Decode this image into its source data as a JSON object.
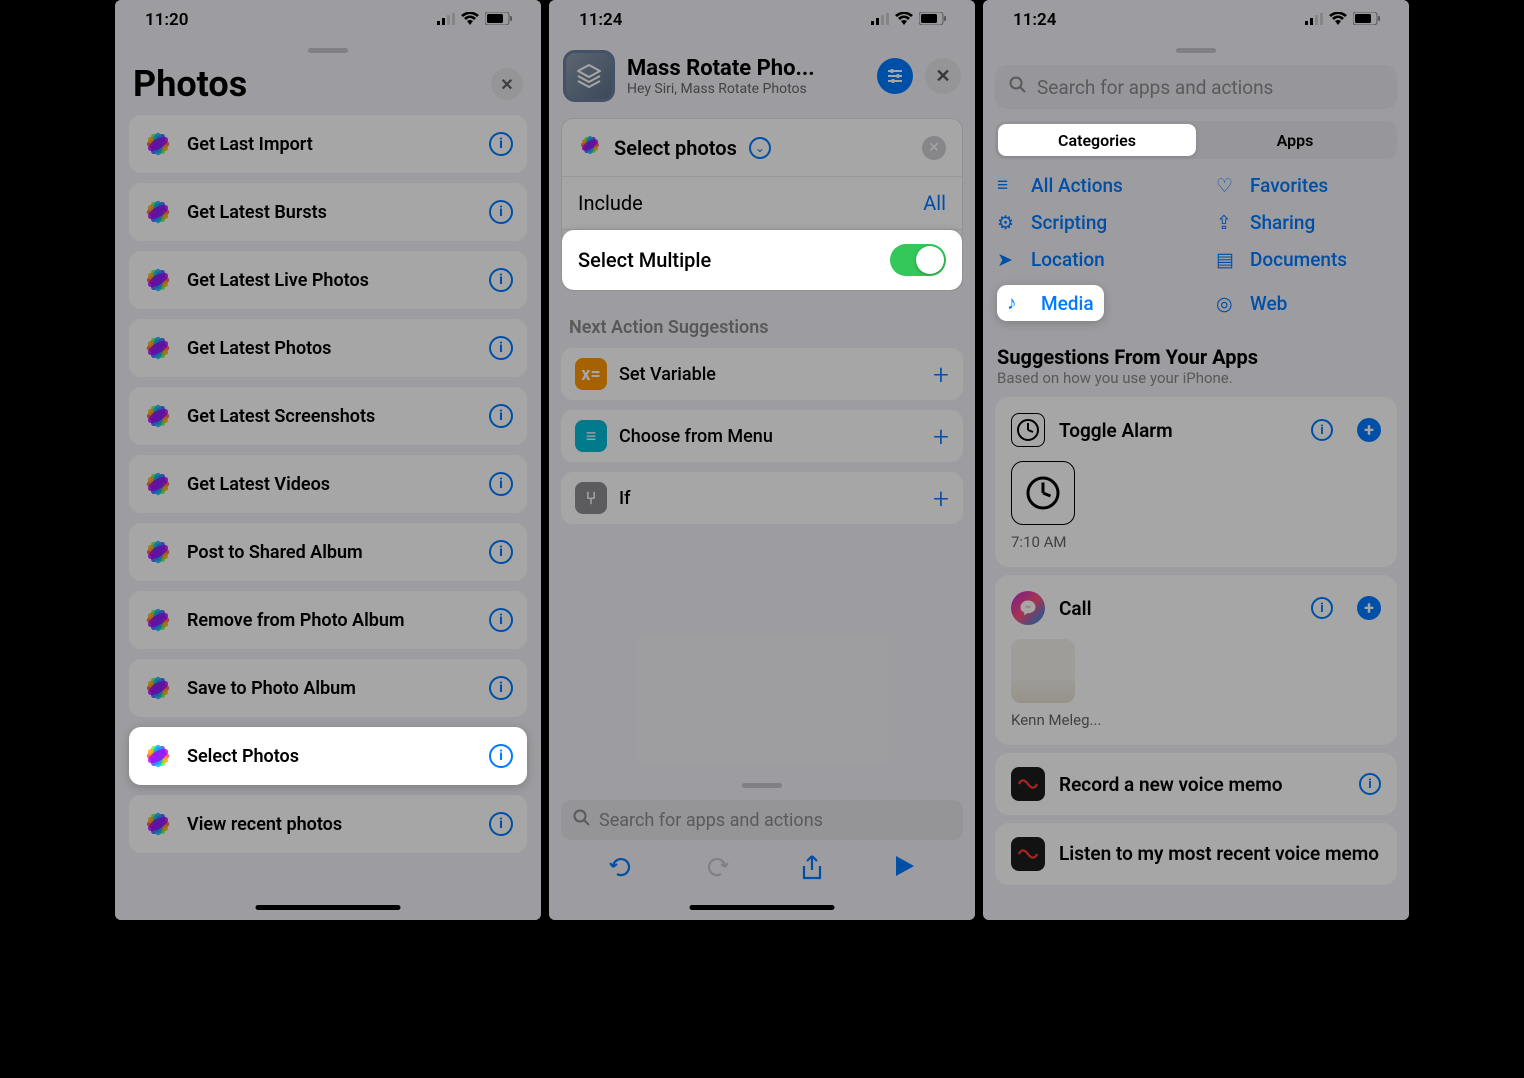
{
  "phone1": {
    "time": "11:20",
    "title": "Photos",
    "items": [
      "Get Last Import",
      "Get Latest Bursts",
      "Get Latest Live Photos",
      "Get Latest Photos",
      "Get Latest Screenshots",
      "Get Latest Videos",
      "Post to Shared Album",
      "Remove from Photo Album",
      "Save to Photo Album",
      "Select Photos",
      "View recent photos"
    ],
    "highlight_index": 9
  },
  "phone2": {
    "time": "11:24",
    "title": "Mass Rotate Pho...",
    "subtitle": "Hey Siri, Mass Rotate Photos",
    "action_name": "Select photos",
    "include_label": "Include",
    "include_value": "All",
    "toggle_label": "Select Multiple",
    "suggestions_header": "Next Action Suggestions",
    "suggestions": [
      {
        "icon": "x=",
        "bg": "#ff9500",
        "label": "Set Variable"
      },
      {
        "icon": "≡",
        "bg": "#00bcd4",
        "label": "Choose from Menu"
      },
      {
        "icon": "⑂",
        "bg": "#8e8e93",
        "label": "If"
      }
    ],
    "search_placeholder": "Search for apps and actions"
  },
  "phone3": {
    "time": "11:24",
    "search_placeholder": "Search for apps and actions",
    "seg": [
      "Categories",
      "Apps"
    ],
    "active_seg": 0,
    "cats": [
      {
        "icon": "≡",
        "label": "All Actions"
      },
      {
        "icon": "♡",
        "label": "Favorites"
      },
      {
        "icon": "⚙",
        "label": "Scripting"
      },
      {
        "icon": "⇪",
        "label": "Sharing"
      },
      {
        "icon": "➤",
        "label": "Location"
      },
      {
        "icon": "▤",
        "label": "Documents"
      },
      {
        "icon": "♪",
        "label": "Media"
      },
      {
        "icon": "◎",
        "label": "Web"
      }
    ],
    "highlight_cat": 6,
    "section_title": "Suggestions From Your Apps",
    "section_sub": "Based on how you use your iPhone.",
    "sugg1": {
      "title": "Toggle Alarm",
      "detail": "7:10 AM"
    },
    "sugg2": {
      "title": "Call",
      "detail": "Kenn Meleg..."
    },
    "sugg3": {
      "title": "Record a new voice memo"
    },
    "sugg4": {
      "title": "Listen to my most recent voice memo"
    }
  }
}
